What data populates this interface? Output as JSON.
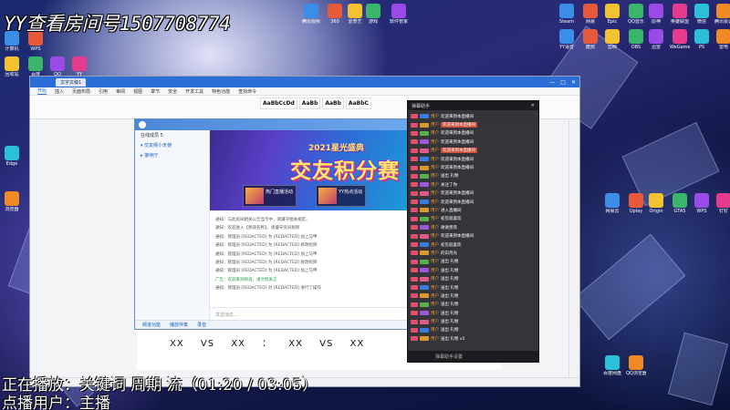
{
  "overlay": {
    "title": "YY查看房间号1507708774",
    "status_line_1": "正在播放：关键词   周期   流（01:20 / 03:05）",
    "status_line_2": "点播用户：主播"
  },
  "wps": {
    "tab_label": "文字文稿1",
    "menu": [
      "开始",
      "插入",
      "页面布局",
      "引用",
      "审阅",
      "视图",
      "章节",
      "安全",
      "开发工具",
      "特色功能",
      "查找命令"
    ],
    "styles": [
      "AaBbCcDd",
      "AaBb",
      "AaBb",
      "AaBbC"
    ],
    "document_line": "XX  VS  XX  ：  XX  VS  XX"
  },
  "yy": {
    "sidebar": [
      "在线成员 5",
      "▾ 交友频小天使",
      "  ▸ 接待厅"
    ],
    "banner_subtitle": "2021星光盛典",
    "banner_title": "交友积分赛",
    "cards": [
      "热门直播活动",
      "YY热点活动"
    ],
    "chat": [
      "通知：与此房间相关公告显示中，请遵守相关规定。",
      "通知：欢迎进入【频道名称】，请遵守房间规则",
      "通知：管理员 [REDACTED] 为 [REDACTED] 加上马甲",
      "通知：管理员 [REDACTED] 为 [REDACTED] 修改昵称",
      "通知：管理员 [REDACTED] 为 [REDACTED] 加上马甲",
      "通知：管理员 [REDACTED] 为 [REDACTED] 修改昵称",
      "通知：管理员 [REDACTED] 为 [REDACTED] 加上马甲",
      "广告：欢迎来到频道，请文明发言",
      "通知：管理员 [REDACTED] 对 [REDACTED] 进行了操作"
    ],
    "input_placeholder": "发送消息…",
    "bottom_bar": [
      "频道功能",
      "播放伴奏",
      "录音"
    ]
  },
  "danmaku": {
    "title": "弹幕助手",
    "rows": [
      {
        "name": "用户",
        "text": "欢迎来到本直播间"
      },
      {
        "name": "用户",
        "text": "欢迎来到本直播间"
      },
      {
        "name": "用户",
        "text": "欢迎来到本直播间"
      },
      {
        "name": "用户",
        "text": "欢迎来到本直播间"
      },
      {
        "name": "用户",
        "text": "欢迎来到本直播间"
      },
      {
        "name": "用户",
        "text": "欢迎来到本直播间"
      },
      {
        "name": "用户",
        "text": "欢迎来到本直播间"
      },
      {
        "name": "用户",
        "text": "送出 礼物"
      },
      {
        "name": "用户",
        "text": "关注了你"
      },
      {
        "name": "用户",
        "text": "欢迎来到本直播间"
      },
      {
        "name": "用户",
        "text": "欢迎来到本直播间"
      },
      {
        "name": "用户",
        "text": "进入直播间"
      },
      {
        "name": "用户",
        "text": "初见就喜欢"
      },
      {
        "name": "用户",
        "text": "谢谢贵宾"
      },
      {
        "name": "用户",
        "text": "欢迎来到本直播间"
      },
      {
        "name": "用户",
        "text": "初见就喜欢"
      },
      {
        "name": "用户",
        "text": "的白月光"
      },
      {
        "name": "用户",
        "text": "送出 礼物"
      },
      {
        "name": "用户",
        "text": "送出 礼物"
      },
      {
        "name": "用户",
        "text": "送出 礼物"
      },
      {
        "name": "用户",
        "text": "送出 礼物"
      },
      {
        "name": "用户",
        "text": "送出 礼物"
      },
      {
        "name": "用户",
        "text": "送出 礼物"
      },
      {
        "name": "用户",
        "text": "送出 礼物"
      },
      {
        "name": "用户",
        "text": "送出 礼物"
      },
      {
        "name": "用户",
        "text": "送出 礼物"
      },
      {
        "name": "用户",
        "text": "送出 礼物 x5"
      }
    ],
    "footer": "弹幕助手设置"
  },
  "desktop_icons": {
    "left": [
      "计算机",
      "WPS",
      "回收站",
      "百度",
      "QQ",
      "YY",
      "Edge",
      "浏览器"
    ],
    "top": [
      "腾讯视频",
      "360",
      "爱奇艺",
      "游戏",
      "软件管家"
    ],
    "right": [
      "Steam",
      "网易",
      "Epic",
      "QQ音乐",
      "原神",
      "英雄联盟",
      "微信",
      "腾讯会议",
      "YY语音",
      "酷狗",
      "剪映",
      "OBS",
      "迅雷",
      "WeGame",
      "PS",
      "雷电",
      "网易云",
      "Uplay",
      "Origin",
      "GTA5",
      "WPS",
      "钉钉",
      "百度网盘",
      "QQ浏览器"
    ]
  },
  "colors": {
    "wps_accent": "#2b6fd6",
    "yy_accent": "#4b88d8",
    "danmaku_bg": "#26262a",
    "overlay_text": "#ffffff"
  }
}
